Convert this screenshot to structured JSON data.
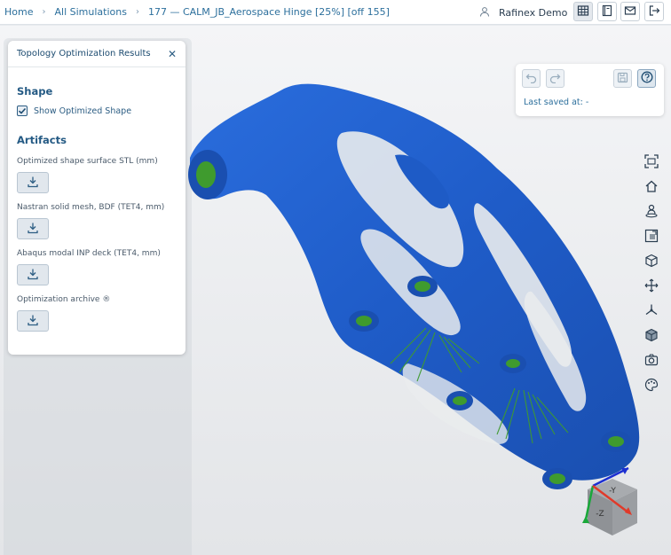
{
  "breadcrumb": {
    "home": "Home",
    "all_simulations": "All Simulations",
    "current": "177 — CALM_JB_Aerospace Hinge [25%] [off 155]"
  },
  "user": {
    "name": "Rafinex Demo",
    "icon": "user-icon"
  },
  "top_actions": [
    {
      "name": "table-icon"
    },
    {
      "name": "notebook-icon"
    },
    {
      "name": "mail-icon"
    },
    {
      "name": "logout-icon"
    }
  ],
  "panel": {
    "title": "Topology Optimization Results",
    "shape_section": "Shape",
    "show_optimized_label": "Show Optimized Shape",
    "show_optimized_checked": true,
    "artifacts_section": "Artifacts",
    "artifacts": [
      {
        "label": "Optimized shape surface STL (mm)"
      },
      {
        "label": "Nastran solid mesh, BDF (TET4, mm)"
      },
      {
        "label": "Abaqus modal INP deck (TET4, mm)"
      },
      {
        "label": "Optimization archive ®"
      }
    ]
  },
  "save_panel": {
    "last_saved": "Last saved at: -"
  },
  "side_tools": [
    "fit-view-icon",
    "home-view-icon",
    "user-pin-icon",
    "section-icon",
    "cube-icon",
    "move-icon",
    "axes-icon",
    "solid-cube-icon",
    "camera-icon",
    "palette-icon"
  ],
  "colors": {
    "model_blue": "#1e5bc6",
    "supports_green": "#3f9b2e",
    "accent": "#2c6f9c"
  },
  "view_cube": {
    "top_label": "-Y",
    "front_label": "-Z"
  }
}
